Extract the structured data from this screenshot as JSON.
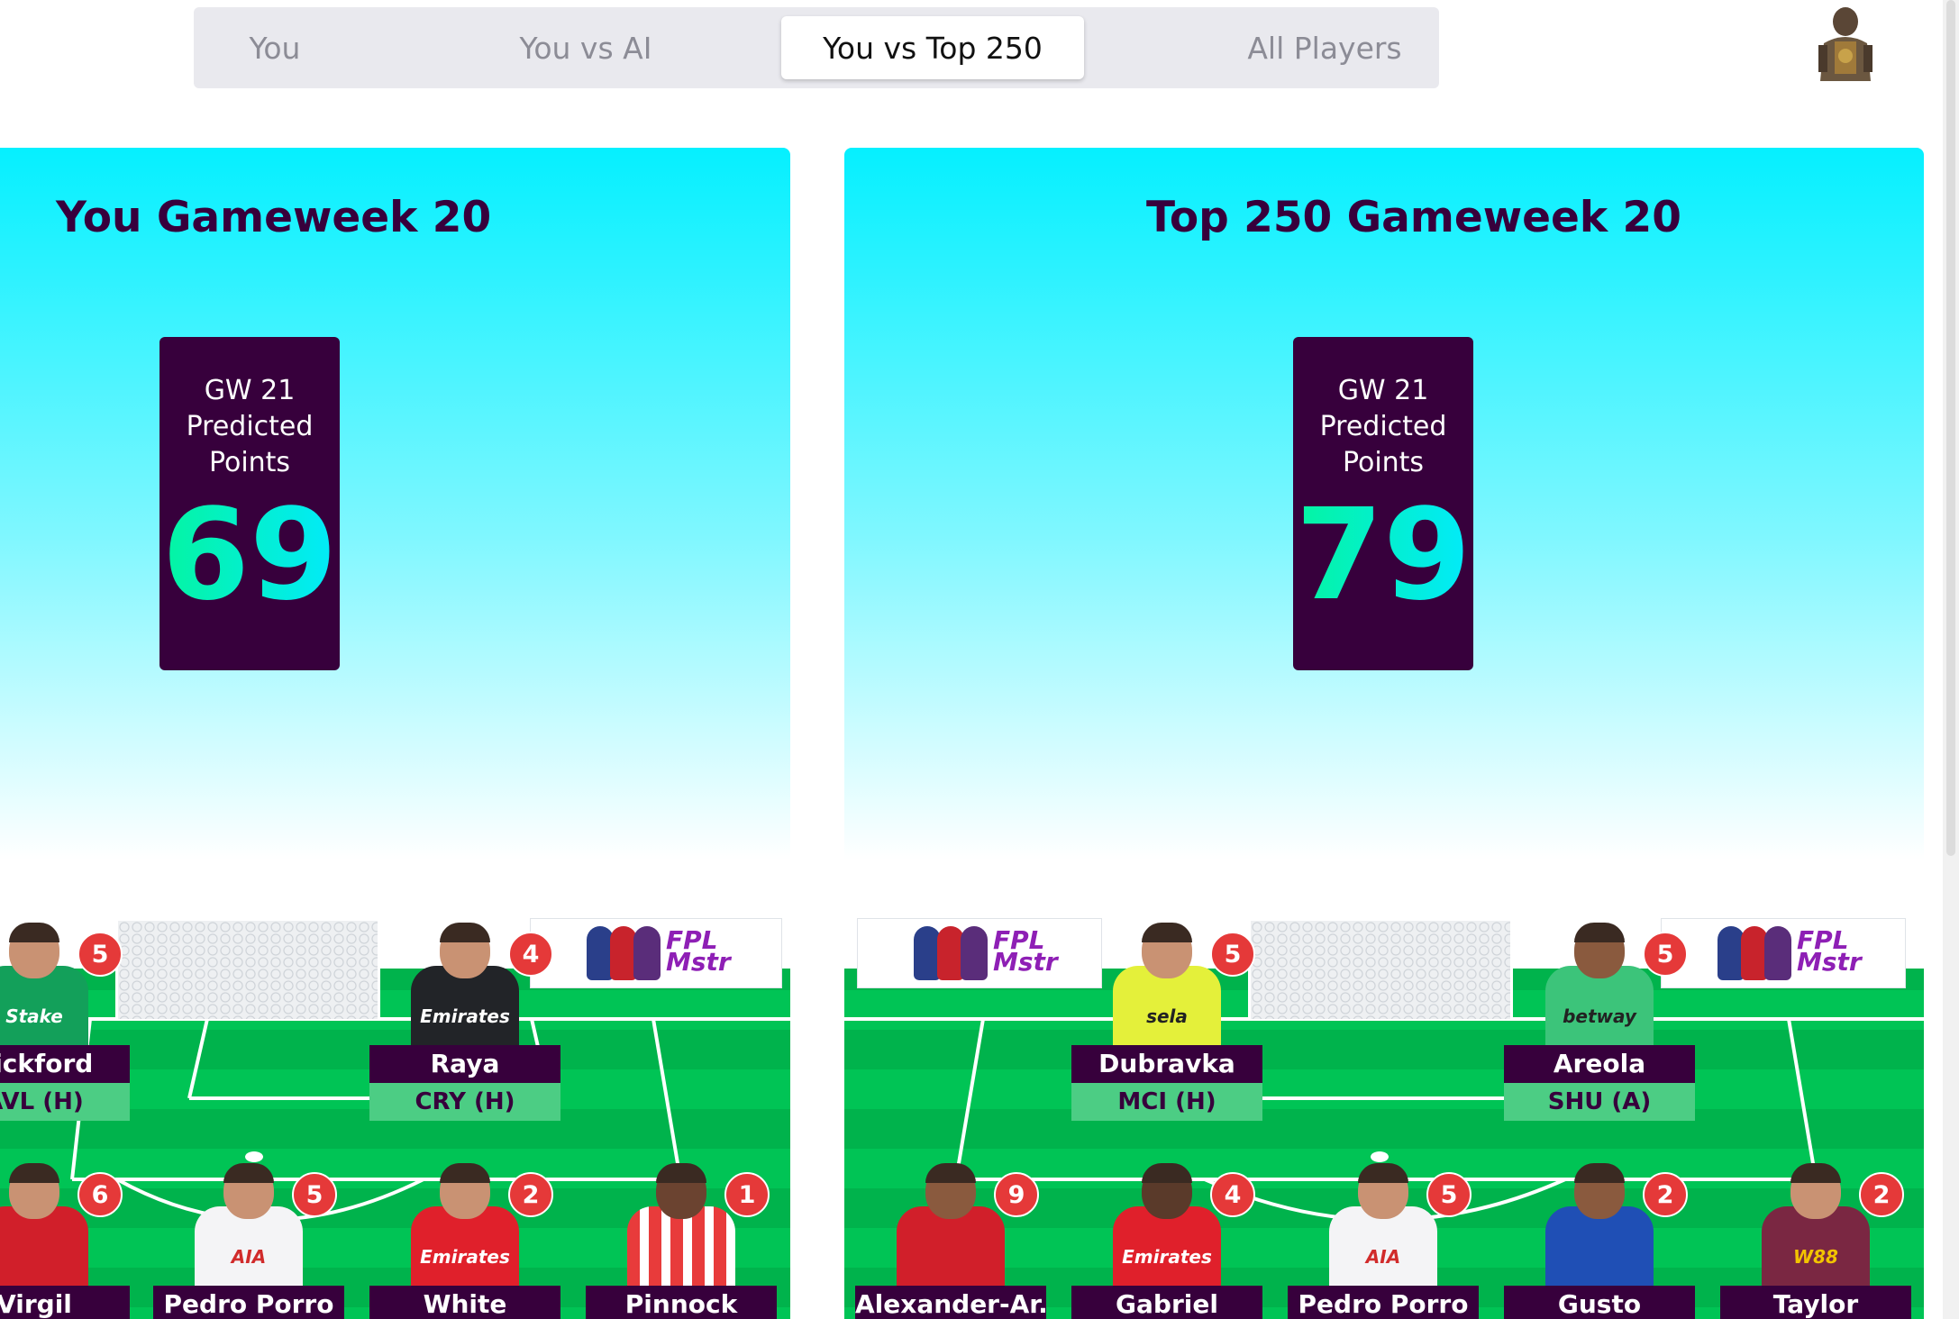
{
  "tabs": [
    {
      "label": "You",
      "active": false
    },
    {
      "label": "You vs AI",
      "active": false
    },
    {
      "label": "You vs Top 250",
      "active": true
    },
    {
      "label": "All Players",
      "active": false
    }
  ],
  "left_panel": {
    "title": "You Gameweek 20",
    "prediction": {
      "label": "GW 21\nPredicted\nPoints",
      "value": "69"
    },
    "goalkeepers": [
      {
        "name": "Pickford",
        "fixture": "AVL (H)",
        "points": "5",
        "kit": "everton"
      },
      {
        "name": "Raya",
        "fixture": "CRY (H)",
        "points": "4",
        "kit": "arsenal-gk"
      }
    ],
    "defenders": [
      {
        "name": "Virgil",
        "points": "6",
        "kit": "liverpool"
      },
      {
        "name": "Pedro Porro",
        "points": "5",
        "kit": "spurs"
      },
      {
        "name": "White",
        "points": "2",
        "kit": "arsenal"
      },
      {
        "name": "Pinnock",
        "points": "1",
        "kit": "brentford"
      }
    ]
  },
  "right_panel": {
    "title": "Top 250 Gameweek 20",
    "prediction": {
      "label": "GW 21\nPredicted\nPoints",
      "value": "79"
    },
    "goalkeepers": [
      {
        "name": "Dubravka",
        "fixture": "MCI (H)",
        "points": "5",
        "kit": "newcastle-gk"
      },
      {
        "name": "Areola",
        "fixture": "SHU (A)",
        "points": "5",
        "kit": "westham-gk"
      }
    ],
    "defenders": [
      {
        "name": "Alexander-Ar...",
        "points": "9",
        "kit": "liverpool"
      },
      {
        "name": "Gabriel",
        "points": "4",
        "kit": "arsenal"
      },
      {
        "name": "Pedro Porro",
        "points": "5",
        "kit": "spurs"
      },
      {
        "name": "Gusto",
        "points": "2",
        "kit": "chelsea"
      },
      {
        "name": "Taylor",
        "points": "2",
        "kit": "burnley"
      }
    ]
  },
  "billboard": {
    "logo_text": "FPL\nMstr"
  },
  "kit_labels": {
    "everton": "Stake",
    "arsenal-gk": "Emirates",
    "liverpool": "",
    "spurs": "AIA",
    "arsenal": "Emirates",
    "brentford": "",
    "newcastle-gk": "sela",
    "westham-gk": "betway",
    "chelsea": "",
    "burnley": "W88"
  },
  "colors": {
    "brand_purple": "#37003c",
    "cyan": "#05f0ff",
    "pitch_light": "#00c454",
    "pitch_dark": "#00b04b",
    "fixture_green": "#4ccd84",
    "points_badge": "#e53939",
    "prediction_gradient": "#04f5a0",
    "kits": {
      "everton": "#13a05a",
      "arsenal-gk": "#222428",
      "liverpool": "#d11f2a",
      "spurs": "#f4f4f6",
      "arsenal": "#e0202b",
      "brentford": "#e83b3b",
      "newcastle-gk": "#e4f03a",
      "westham-gk": "#3cc47a",
      "chelsea": "#1f4fb5",
      "burnley": "#7a2742"
    }
  }
}
